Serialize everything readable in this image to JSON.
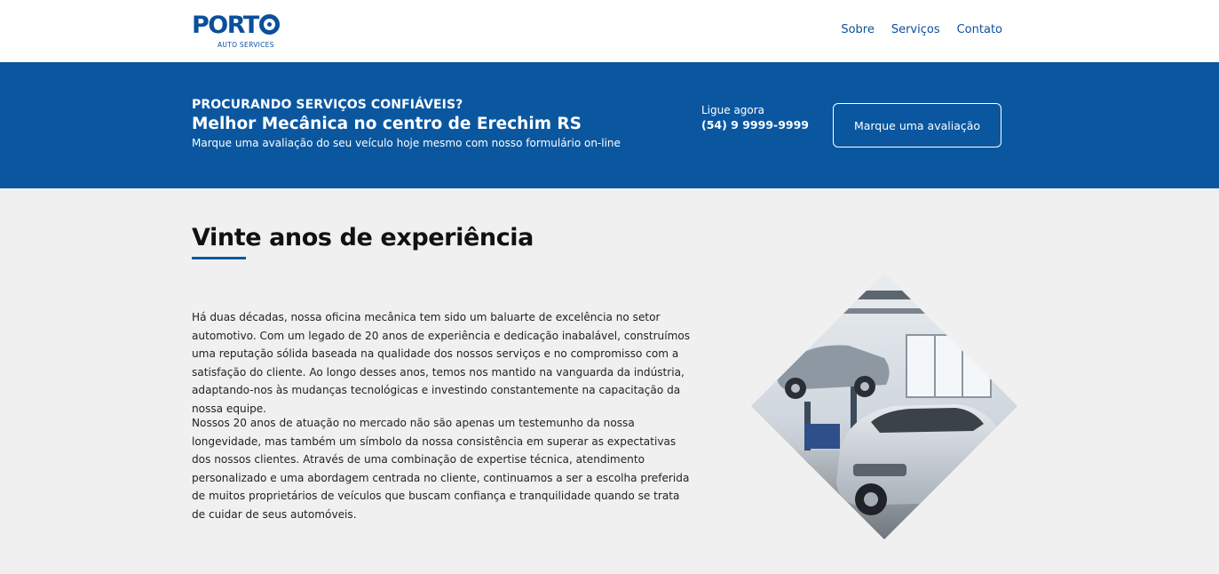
{
  "header": {
    "logo_word": "PORT",
    "logo_sub": "AUTO SERVICES",
    "nav": [
      "Sobre",
      "Serviços",
      "Contato"
    ]
  },
  "banner": {
    "eyebrow": "PROCURANDO SERVIÇOS CONFIÁVEIS?",
    "title": "Melhor Mecânica no centro de Erechim RS",
    "subtitle": "Marque uma avaliação do seu veículo hoje mesmo com nosso formulário on-line",
    "call_label": "Ligue agora",
    "phone": "(54) 9 9999-9999",
    "cta": "Marque uma avaliação"
  },
  "main": {
    "title": "Vinte anos de experiência",
    "paragraph_1": "Há duas décadas, nossa oficina mecânica tem sido um baluarte de excelência no setor automotivo. Com um legado de 20 anos de experiência e dedicação inabalável, construímos uma reputação sólida baseada na qualidade dos nossos serviços e no compromisso com a satisfação do cliente. Ao longo desses anos, temos nos mantido na vanguarda da indústria, adaptando-nos às mudanças tecnológicas e investindo constantemente na capacitação da nossa equipe.",
    "paragraph_2": "Nossos 20 anos de atuação no mercado não são apenas um testemunho da nossa longevidade, mas também um símbolo da nossa consistência em superar as expectativas dos nossos clientes. Através de uma combinação de expertise técnica, atendimento personalizado e uma abordagem centrada no cliente, continuamos a ser a escolha preferida de muitos proprietários de veículos que buscam confiança e tranquilidade quando se trata de cuidar de seus automóveis."
  },
  "colors": {
    "brand_blue": "#0a57a0",
    "page_bg": "#f0f0f0"
  }
}
